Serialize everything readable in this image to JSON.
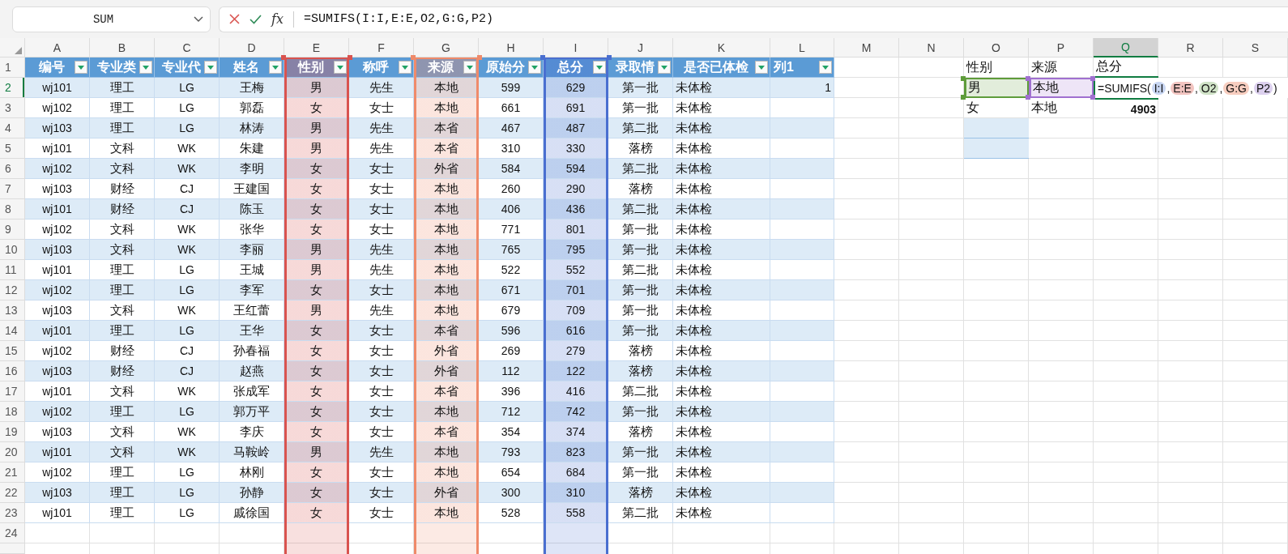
{
  "name_box": "SUM",
  "formula_bar": {
    "fx_label": "fx",
    "formula": "=SUMIFS(I:I,E:E,O2,G:G,P2)"
  },
  "column_headers": [
    {
      "label": "A",
      "selected": false
    },
    {
      "label": "B",
      "selected": false
    },
    {
      "label": "C",
      "selected": false
    },
    {
      "label": "D",
      "selected": false
    },
    {
      "label": "E",
      "selected": false
    },
    {
      "label": "F",
      "selected": false
    },
    {
      "label": "G",
      "selected": false
    },
    {
      "label": "H",
      "selected": false
    },
    {
      "label": "I",
      "selected": false
    },
    {
      "label": "J",
      "selected": false
    },
    {
      "label": "K",
      "selected": false
    },
    {
      "label": "L",
      "selected": false
    },
    {
      "label": "M",
      "selected": false
    },
    {
      "label": "N",
      "selected": false
    },
    {
      "label": "O",
      "selected": false
    },
    {
      "label": "P",
      "selected": false
    },
    {
      "label": "Q",
      "selected": true
    },
    {
      "label": "R",
      "selected": false
    },
    {
      "label": "S",
      "selected": false
    }
  ],
  "row_headers": [
    {
      "label": "1",
      "selected": false
    },
    {
      "label": "2",
      "selected": true
    },
    {
      "label": "3",
      "selected": false
    },
    {
      "label": "4",
      "selected": false
    },
    {
      "label": "5",
      "selected": false
    },
    {
      "label": "6",
      "selected": false
    },
    {
      "label": "7",
      "selected": false
    },
    {
      "label": "8",
      "selected": false
    },
    {
      "label": "9",
      "selected": false
    },
    {
      "label": "10",
      "selected": false
    },
    {
      "label": "11",
      "selected": false
    },
    {
      "label": "12",
      "selected": false
    },
    {
      "label": "13",
      "selected": false
    },
    {
      "label": "14",
      "selected": false
    },
    {
      "label": "15",
      "selected": false
    },
    {
      "label": "16",
      "selected": false
    },
    {
      "label": "17",
      "selected": false
    },
    {
      "label": "18",
      "selected": false
    },
    {
      "label": "19",
      "selected": false
    },
    {
      "label": "20",
      "selected": false
    },
    {
      "label": "21",
      "selected": false
    },
    {
      "label": "22",
      "selected": false
    },
    {
      "label": "23",
      "selected": false
    },
    {
      "label": "24",
      "selected": false
    }
  ],
  "table": {
    "columns": [
      {
        "label": "编号"
      },
      {
        "label": "专业类"
      },
      {
        "label": "专业代"
      },
      {
        "label": "姓名"
      },
      {
        "label": "性别",
        "color": "#d9534f"
      },
      {
        "label": "称呼"
      },
      {
        "label": "来源",
        "color": "#ef8a6a"
      },
      {
        "label": "原始分"
      },
      {
        "label": "总分",
        "color": "#4a6fd0"
      },
      {
        "label": "录取情"
      },
      {
        "label": "是否已体检"
      },
      {
        "label": "列1"
      }
    ],
    "rows": [
      [
        "wj101",
        "理工",
        "LG",
        "王梅",
        "男",
        "先生",
        "本地",
        "599",
        "629",
        "第一批",
        "未体检",
        "1"
      ],
      [
        "wj102",
        "理工",
        "LG",
        "郭磊",
        "女",
        "女士",
        "本地",
        "661",
        "691",
        "第一批",
        "未体检"
      ],
      [
        "wj103",
        "理工",
        "LG",
        "林涛",
        "男",
        "先生",
        "本省",
        "467",
        "487",
        "第二批",
        "未体检"
      ],
      [
        "wj101",
        "文科",
        "WK",
        "朱建",
        "男",
        "先生",
        "本省",
        "310",
        "330",
        "落榜",
        "未体检"
      ],
      [
        "wj102",
        "文科",
        "WK",
        "李明",
        "女",
        "女士",
        "外省",
        "584",
        "594",
        "第二批",
        "未体检"
      ],
      [
        "wj103",
        "财经",
        "CJ",
        "王建国",
        "女",
        "女士",
        "本地",
        "260",
        "290",
        "落榜",
        "未体检"
      ],
      [
        "wj101",
        "财经",
        "CJ",
        "陈玉",
        "女",
        "女士",
        "本地",
        "406",
        "436",
        "第二批",
        "未体检"
      ],
      [
        "wj102",
        "文科",
        "WK",
        "张华",
        "女",
        "女士",
        "本地",
        "771",
        "801",
        "第一批",
        "未体检"
      ],
      [
        "wj103",
        "文科",
        "WK",
        "李丽",
        "男",
        "先生",
        "本地",
        "765",
        "795",
        "第一批",
        "未体检"
      ],
      [
        "wj101",
        "理工",
        "LG",
        "王城",
        "男",
        "先生",
        "本地",
        "522",
        "552",
        "第二批",
        "未体检"
      ],
      [
        "wj102",
        "理工",
        "LG",
        "李军",
        "女",
        "女士",
        "本地",
        "671",
        "701",
        "第一批",
        "未体检"
      ],
      [
        "wj103",
        "文科",
        "WK",
        "王红蕾",
        "男",
        "先生",
        "本地",
        "679",
        "709",
        "第一批",
        "未体检"
      ],
      [
        "wj101",
        "理工",
        "LG",
        "王华",
        "女",
        "女士",
        "本省",
        "596",
        "616",
        "第一批",
        "未体检"
      ],
      [
        "wj102",
        "财经",
        "CJ",
        "孙春福",
        "女",
        "女士",
        "外省",
        "269",
        "279",
        "落榜",
        "未体检"
      ],
      [
        "wj103",
        "财经",
        "CJ",
        "赵燕",
        "女",
        "女士",
        "外省",
        "112",
        "122",
        "落榜",
        "未体检"
      ],
      [
        "wj101",
        "文科",
        "WK",
        "张成军",
        "女",
        "女士",
        "本省",
        "396",
        "416",
        "第二批",
        "未体检"
      ],
      [
        "wj102",
        "理工",
        "LG",
        "郭万平",
        "女",
        "女士",
        "本地",
        "712",
        "742",
        "第一批",
        "未体检"
      ],
      [
        "wj103",
        "文科",
        "WK",
        "李庆",
        "女",
        "女士",
        "本省",
        "354",
        "374",
        "落榜",
        "未体检"
      ],
      [
        "wj101",
        "文科",
        "WK",
        "马鞍岭",
        "男",
        "先生",
        "本地",
        "793",
        "823",
        "第一批",
        "未体检"
      ],
      [
        "wj102",
        "理工",
        "LG",
        "林刚",
        "女",
        "女士",
        "本地",
        "654",
        "684",
        "第一批",
        "未体检"
      ],
      [
        "wj103",
        "理工",
        "LG",
        "孙静",
        "女",
        "女士",
        "外省",
        "300",
        "310",
        "落榜",
        "未体检"
      ],
      [
        "wj101",
        "理工",
        "LG",
        "戚徐国",
        "女",
        "女士",
        "本地",
        "528",
        "558",
        "第二批",
        "未体检"
      ]
    ]
  },
  "criteria": {
    "headers": [
      "性别",
      "来源",
      "总分"
    ],
    "rows": [
      {
        "cells": [
          {
            "text": "男",
            "color": "#5e9c3a"
          },
          {
            "text": "本地",
            "color": "#a070d0"
          }
        ],
        "editing": {
          "prefix": "=SUMIFS(",
          "refs": [
            {
              "text": "I:I",
              "color": "#c8d6f2"
            },
            {
              "text": "E:E",
              "color": "#f2c4c0"
            },
            {
              "text": "O2",
              "color": "#cfe2c6"
            },
            {
              "text": "G:G",
              "color": "#f7cdbf"
            },
            {
              "text": "P2",
              "color": "#dcd0ee"
            }
          ],
          "separator": ",",
          "suffix": ")"
        }
      },
      {
        "cells": [
          {
            "text": "女"
          },
          {
            "text": "本地"
          }
        ],
        "result": "4903"
      }
    ]
  }
}
